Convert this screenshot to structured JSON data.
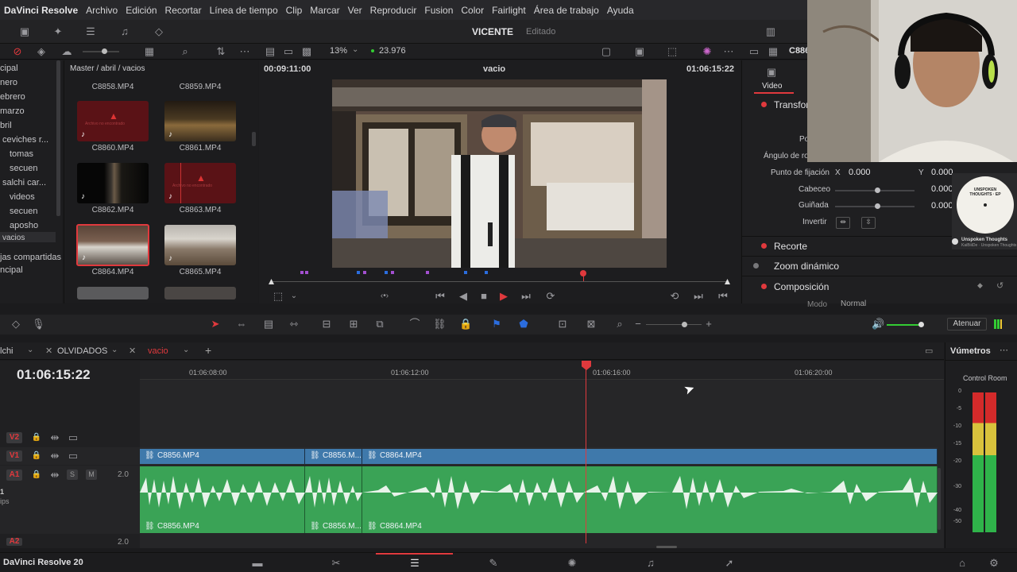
{
  "menu": [
    "DaVinci Resolve",
    "Archivo",
    "Edición",
    "Recortar",
    "Línea de tiempo",
    "Clip",
    "Marcar",
    "Ver",
    "Reproducir",
    "Fusion",
    "Color",
    "Fairlight",
    "Área de trabajo",
    "Ayuda"
  ],
  "project": {
    "name": "VICENTE",
    "status": "Editado"
  },
  "viewer_bar": {
    "zoom": "13%",
    "fps": "23.976",
    "clip_code": "C886"
  },
  "media_pool": {
    "breadcrumb": "Master / abril / vacios",
    "tree": [
      "cipal",
      "nero",
      "ebrero",
      "marzo",
      "bril",
      "ceviches r...",
      "tomas",
      "secuen",
      "salchi car...",
      "videos",
      "secuen",
      "aposho",
      "vacios"
    ],
    "shared_label": "jas compartidas",
    "shared_item": "ncipal",
    "clips": [
      "C8858.MP4",
      "C8859.MP4",
      "C8860.MP4",
      "C8861.MP4",
      "C8862.MP4",
      "C8863.MP4",
      "C8864.MP4",
      "C8865.MP4"
    ],
    "offline_text": "Archivo no encontrado"
  },
  "viewer": {
    "timecode_left": "00:09:11:00",
    "title": "vacio",
    "timecode_right": "01:06:15:22"
  },
  "inspector": {
    "tab": "Video",
    "section_transform": "Transfor",
    "pos_label": "Po",
    "angle_label": "Ángulo de ro",
    "anchor_label": "Punto de fijación",
    "anchor_x_label": "X",
    "anchor_x": "0.000",
    "anchor_y_label": "Y",
    "anchor_y": "0.000",
    "pitch_label": "Cabeceo",
    "pitch": "0.000",
    "yaw_label": "Guiñada",
    "yaw": "0.000",
    "flip_label": "Invertir",
    "crop": "Recorte",
    "dynamic_zoom": "Zoom dinámico",
    "composite": "Composición",
    "mode_label": "Modo",
    "mode_value": "Normal"
  },
  "album": {
    "title": "UNSPOKEN THOUGHTS · EP",
    "caption": "Unspoken Thoughts",
    "subcaption": "KaiBiiiDe · Unspoken Thoughts"
  },
  "editbar": {
    "mute_label": "Atenuar"
  },
  "timeline": {
    "tabs": [
      "lchi",
      "OLVIDADOS",
      "vacio"
    ],
    "timecode": "01:06:15:22",
    "ruler": [
      "01:06:08:00",
      "01:06:12:00",
      "01:06:16:00",
      "01:06:20:00"
    ],
    "tracks": {
      "v2": "V2",
      "v1": "V1",
      "a1": "A1",
      "a2": "A2",
      "a1_level": "2.0",
      "a2_level": "2.0",
      "a1_side": "1",
      "a1_clips": "ips"
    },
    "video_clips": [
      "C8856.MP4",
      "C8856.M...",
      "C8864.MP4"
    ],
    "audio_clips": [
      "C8856.MP4",
      "C8856.M...",
      "C8864.MP4"
    ]
  },
  "meters": {
    "title": "Vúmetros",
    "room": "Control Room",
    "scale": [
      "0",
      "-5",
      "-10",
      "-15",
      "-20",
      "-30",
      "-40",
      "-50"
    ]
  },
  "footer": {
    "version": "DaVinci Resolve 20"
  }
}
